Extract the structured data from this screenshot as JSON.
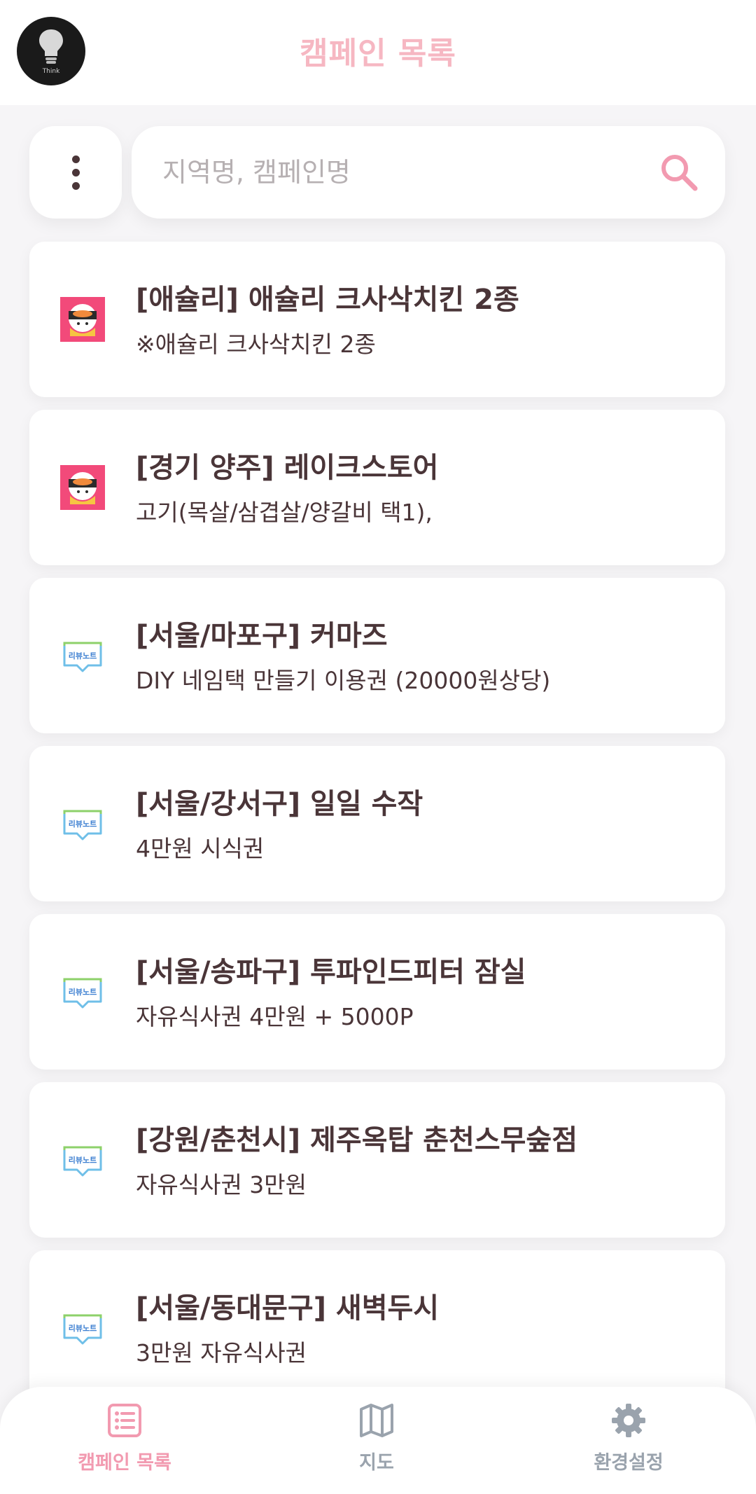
{
  "header": {
    "title": "캠페인 목록",
    "logo_text": "Think",
    "logo_icon": "lightbulb-icon"
  },
  "search": {
    "placeholder": "지역명, 캠페인명",
    "value": "",
    "menu_icon": "kebab-menu-icon",
    "search_icon": "search-icon"
  },
  "campaigns": [
    {
      "title": "[애슐리] 애슐리 크사삭치킨 2종",
      "subtitle": "※애슐리 크사삭치킨 2종",
      "source_icon": "sushi-app-icon"
    },
    {
      "title": "[경기 양주] 레이크스토어",
      "subtitle": "고기(목살/삼겹살/양갈비 택1),",
      "source_icon": "sushi-app-icon"
    },
    {
      "title": "[서울/마포구] 커마즈",
      "subtitle": "DIY 네임택 만들기 이용권 (20000원상당)",
      "source_icon": "review-note-icon"
    },
    {
      "title": "[서울/강서구] 일일 수작",
      "subtitle": "4만원 시식권",
      "source_icon": "review-note-icon"
    },
    {
      "title": "[서울/송파구] 투파인드피터 잠실",
      "subtitle": "자유식사권 4만원 + 5000P",
      "source_icon": "review-note-icon"
    },
    {
      "title": "[강원/춘천시] 제주옥탑 춘천스무숲점",
      "subtitle": "자유식사권 3만원",
      "source_icon": "review-note-icon"
    },
    {
      "title": "[서울/동대문구] 새벽두시",
      "subtitle": "3만원 자유식사권",
      "source_icon": "review-note-icon"
    }
  ],
  "review_note_label": "리뷰노트",
  "nav": {
    "list_label": "캠페인 목록",
    "map_label": "지도",
    "settings_label": "환경설정"
  },
  "colors": {
    "accent": "#f29ab0",
    "title": "#f6b7c2",
    "text": "#4a3538",
    "inactive": "#9aa3ad"
  }
}
